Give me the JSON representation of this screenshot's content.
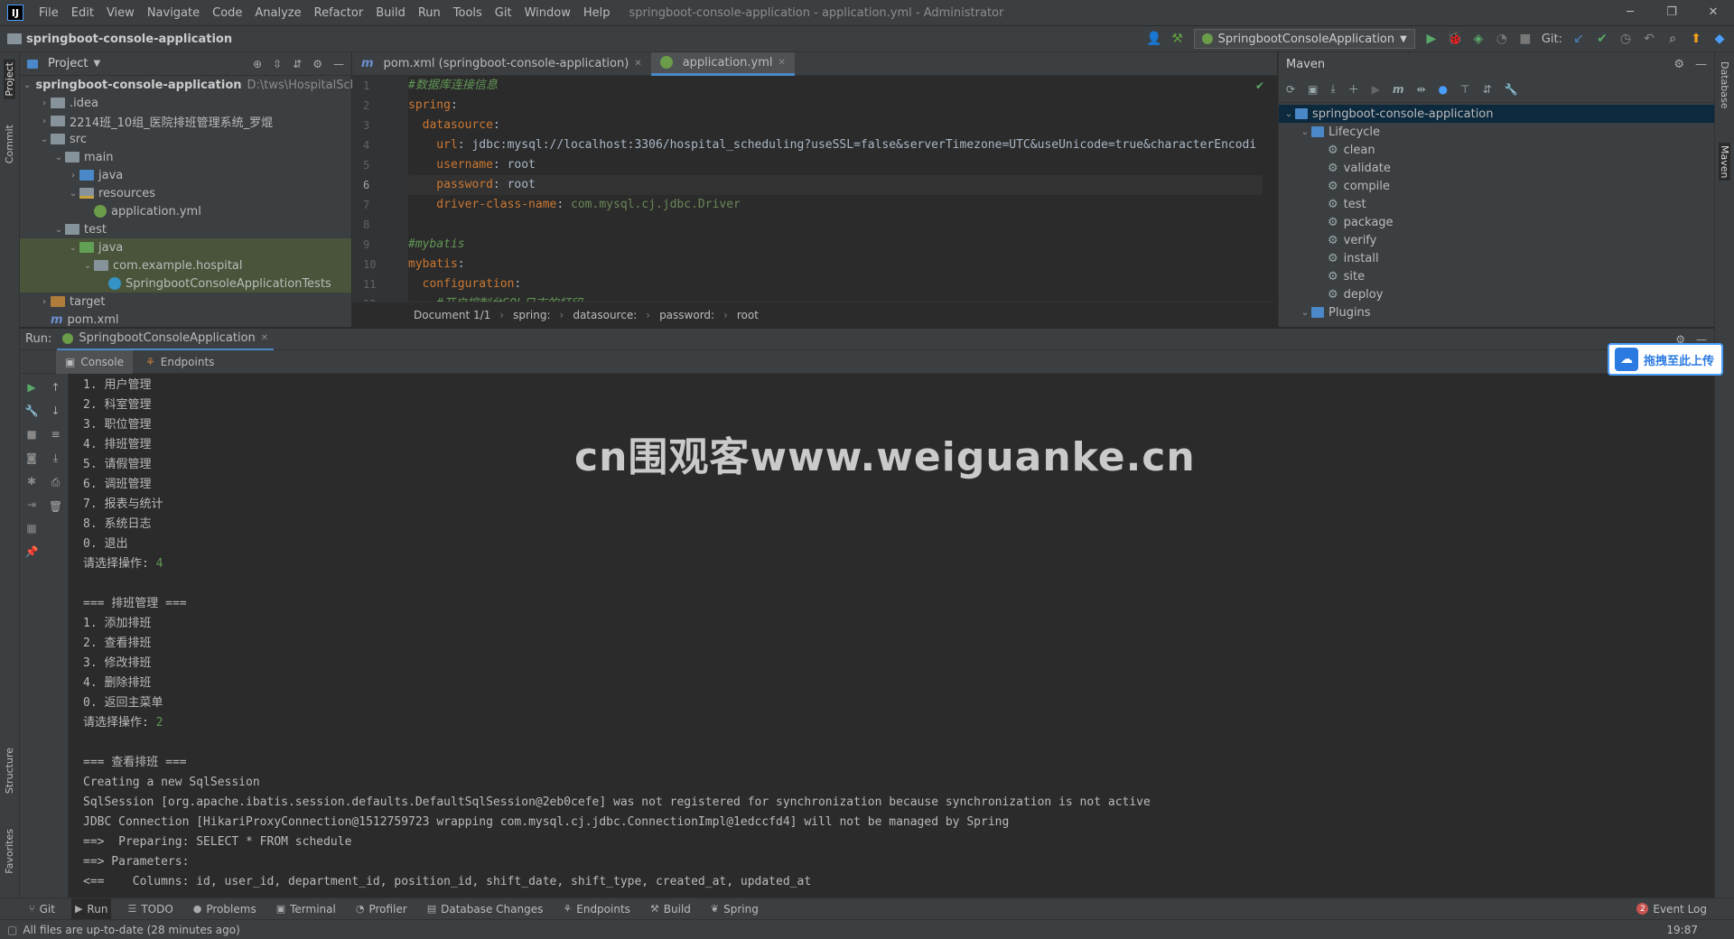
{
  "menubar": {
    "logo": "IJ",
    "items": [
      "File",
      "Edit",
      "View",
      "Navigate",
      "Code",
      "Analyze",
      "Refactor",
      "Build",
      "Run",
      "Tools",
      "Git",
      "Window",
      "Help"
    ],
    "title": "springboot-console-application - application.yml - Administrator"
  },
  "navbar": {
    "project": "springboot-console-application",
    "run_config": "SpringbootConsoleApplication",
    "git_label": "Git:"
  },
  "left_stripe": {
    "project": "Project",
    "commit": "Commit",
    "structure": "Structure",
    "favorites": "Favorites"
  },
  "right_stripe": {
    "database": "Database",
    "maven": "Maven"
  },
  "project_panel": {
    "title": "Project",
    "tree": [
      {
        "label": "springboot-console-application",
        "extra": "D:\\tws\\HospitalSched",
        "level": 0,
        "arrow": "⌄",
        "icon": "folder",
        "bold": true
      },
      {
        "label": ".idea",
        "level": 1,
        "arrow": "›",
        "icon": "folder"
      },
      {
        "label": "2214班_10组_医院排班管理系统_罗焜",
        "level": 1,
        "arrow": "›",
        "icon": "folder"
      },
      {
        "label": "src",
        "level": 1,
        "arrow": "⌄",
        "icon": "folder"
      },
      {
        "label": "main",
        "level": 2,
        "arrow": "⌄",
        "icon": "folder"
      },
      {
        "label": "java",
        "level": 3,
        "arrow": "›",
        "icon": "folder-blue"
      },
      {
        "label": "resources",
        "level": 3,
        "arrow": "⌄",
        "icon": "folder-res"
      },
      {
        "label": "application.yml",
        "level": 4,
        "arrow": "",
        "icon": "yml"
      },
      {
        "label": "test",
        "level": 2,
        "arrow": "⌄",
        "icon": "folder"
      },
      {
        "label": "java",
        "level": 3,
        "arrow": "⌄",
        "icon": "folder-green",
        "testbg": true
      },
      {
        "label": "com.example.hospital",
        "level": 4,
        "arrow": "⌄",
        "icon": "folder",
        "testbg": true
      },
      {
        "label": "SpringbootConsoleApplicationTests",
        "level": 5,
        "arrow": "",
        "icon": "java",
        "testbg": true
      },
      {
        "label": "target",
        "level": 1,
        "arrow": "›",
        "icon": "folder-orange"
      },
      {
        "label": "pom.xml",
        "level": 1,
        "arrow": "",
        "icon": "m"
      }
    ]
  },
  "editor": {
    "tabs": [
      {
        "label": "pom.xml (springboot-console-application)",
        "icon": "m",
        "active": false
      },
      {
        "label": "application.yml",
        "icon": "yml",
        "active": true
      }
    ],
    "line_numbers": [
      "1",
      "2",
      "3",
      "4",
      "5",
      "6",
      "7",
      "8",
      "9",
      "10",
      "11",
      "12"
    ],
    "lines": [
      {
        "parts": [
          {
            "t": "#数据库连接信息",
            "c": "cmt"
          }
        ]
      },
      {
        "parts": [
          {
            "t": "spring",
            "c": "key"
          },
          {
            "t": ":",
            "c": "val"
          }
        ]
      },
      {
        "parts": [
          {
            "t": "  datasource",
            "c": "key"
          },
          {
            "t": ":",
            "c": "val"
          }
        ]
      },
      {
        "parts": [
          {
            "t": "    url",
            "c": "key"
          },
          {
            "t": ": jdbc:mysql://localhost:3306/hospital_scheduling?useSSL=false&serverTimezone=UTC&useUnicode=true&characterEncodi",
            "c": "val"
          }
        ]
      },
      {
        "parts": [
          {
            "t": "    username",
            "c": "key"
          },
          {
            "t": ": root",
            "c": "val"
          }
        ]
      },
      {
        "parts": [
          {
            "t": "    password",
            "c": "key"
          },
          {
            "t": ": root",
            "c": "val"
          }
        ],
        "cur": true
      },
      {
        "parts": [
          {
            "t": "    driver-class-name",
            "c": "key"
          },
          {
            "t": ": ",
            "c": "val"
          },
          {
            "t": "com.mysql.cj.jdbc.Driver",
            "c": "val2"
          }
        ]
      },
      {
        "parts": [
          {
            "t": "",
            "c": "val"
          }
        ]
      },
      {
        "parts": [
          {
            "t": "#mybatis",
            "c": "cmt"
          }
        ]
      },
      {
        "parts": [
          {
            "t": "mybatis",
            "c": "key"
          },
          {
            "t": ":",
            "c": "val"
          }
        ]
      },
      {
        "parts": [
          {
            "t": "  configuration",
            "c": "key"
          },
          {
            "t": ":",
            "c": "val"
          }
        ]
      },
      {
        "parts": [
          {
            "t": "    #开启控制台SQL日志的打印",
            "c": "cmt"
          }
        ]
      }
    ],
    "breadcrumb": [
      "Document 1/1",
      "spring:",
      "datasource:",
      "password:",
      "root"
    ]
  },
  "maven": {
    "title": "Maven",
    "root": "springboot-console-application",
    "lifecycle_label": "Lifecycle",
    "lifecycle": [
      "clean",
      "validate",
      "compile",
      "test",
      "package",
      "verify",
      "install",
      "site",
      "deploy"
    ],
    "plugins_label": "Plugins"
  },
  "run": {
    "label": "Run:",
    "tab": "SpringbootConsoleApplication",
    "subtabs": [
      "Console",
      "Endpoints"
    ],
    "console": [
      {
        "text": "1. 用户管理"
      },
      {
        "text": "2. 科室管理"
      },
      {
        "text": "3. 职位管理"
      },
      {
        "text": "4. 排班管理"
      },
      {
        "text": "5. 请假管理"
      },
      {
        "text": "6. 调班管理"
      },
      {
        "text": "7. 报表与统计"
      },
      {
        "text": "8. 系统日志"
      },
      {
        "text": "0. 退出"
      },
      {
        "text": "请选择操作: ",
        "input": "4"
      },
      {
        "text": ""
      },
      {
        "text": "=== 排班管理 ==="
      },
      {
        "text": "1. 添加排班"
      },
      {
        "text": "2. 查看排班"
      },
      {
        "text": "3. 修改排班"
      },
      {
        "text": "4. 删除排班"
      },
      {
        "text": "0. 返回主菜单"
      },
      {
        "text": "请选择操作: ",
        "input": "2"
      },
      {
        "text": ""
      },
      {
        "text": "=== 查看排班 ==="
      },
      {
        "text": "Creating a new SqlSession"
      },
      {
        "text": "SqlSession [org.apache.ibatis.session.defaults.DefaultSqlSession@2eb0cefe] was not registered for synchronization because synchronization is not active"
      },
      {
        "text": "JDBC Connection [HikariProxyConnection@1512759723 wrapping com.mysql.cj.jdbc.ConnectionImpl@1edccfd4] will not be managed by Spring"
      },
      {
        "text": "==>  Preparing: SELECT * FROM schedule"
      },
      {
        "text": "==> Parameters: "
      },
      {
        "text": "<==    Columns: id, user_id, department_id, position_id, shift_date, shift_type, created_at, updated_at"
      }
    ]
  },
  "bottom_tools": [
    "Git",
    "Run",
    "TODO",
    "Problems",
    "Terminal",
    "Profiler",
    "Database Changes",
    "Endpoints",
    "Build",
    "Spring"
  ],
  "event_log": {
    "count": "2",
    "label": "Event Log"
  },
  "status": {
    "message": "All files are up-to-date (28 minutes ago)",
    "time": "19:87"
  },
  "overlay": {
    "watermark": "cn围观客www.weiguanke.cn",
    "upload": "拖拽至此上传"
  },
  "colors": {
    "accent": "#4a88c7",
    "bg": "#2b2b2b",
    "panel": "#3c3f41"
  }
}
